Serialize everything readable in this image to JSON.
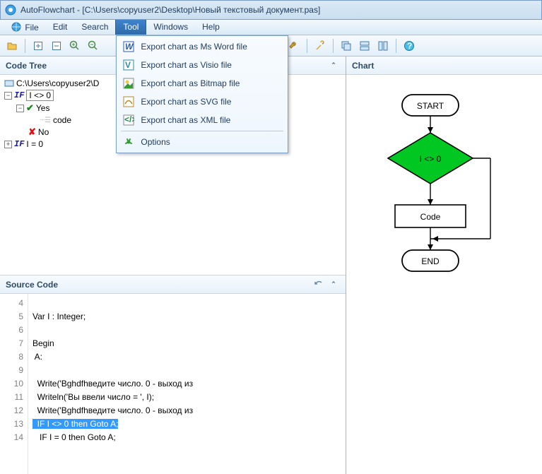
{
  "title": "AutoFlowchart - [C:\\Users\\copyuser2\\Desktop\\Новый текстовый документ.pas]",
  "menubar": {
    "file": "File",
    "edit": "Edit",
    "search": "Search",
    "tool": "Tool",
    "windows": "Windows",
    "help": "Help"
  },
  "tool_menu": {
    "export_word": "Export chart as Ms Word file",
    "export_visio": "Export chart as Visio file",
    "export_bitmap": "Export chart as Bitmap file",
    "export_svg": "Export chart as SVG file",
    "export_xml": "Export chart as XML file",
    "options": "Options"
  },
  "panels": {
    "code_tree": "Code Tree",
    "source_code": "Source Code",
    "chart": "Chart"
  },
  "tree": {
    "root": "C:\\Users\\copyuser2\\D",
    "n1": "I <> 0",
    "n1_yes": "Yes",
    "n1_code": "code",
    "n1_no": "No",
    "n2": "I = 0"
  },
  "source": {
    "lines": {
      "l4": "",
      "l5": "Var I : Integer;",
      "l6": "",
      "l7": "Begin",
      "l8": " A:",
      "l9": "",
      "l10": "  Write('Bghdfhведите число. 0 - выход из",
      "l11": "  Writeln('Вы ввели число = ', I);",
      "l12": "  Write('Bghdfhведите число. 0 - выход из",
      "l13": "  IF I <> 0 then Goto A;",
      "l14": "   IF I = 0 then Goto A;"
    },
    "linenums": [
      "4",
      "5",
      "6",
      "7",
      "8",
      "9",
      "10",
      "11",
      "12",
      "13",
      "14"
    ]
  },
  "chart": {
    "start": "START",
    "cond": "I <> 0",
    "code": "Code",
    "end": "END"
  },
  "colors": {
    "accent": "#00c721",
    "selection": "#3399ff"
  }
}
